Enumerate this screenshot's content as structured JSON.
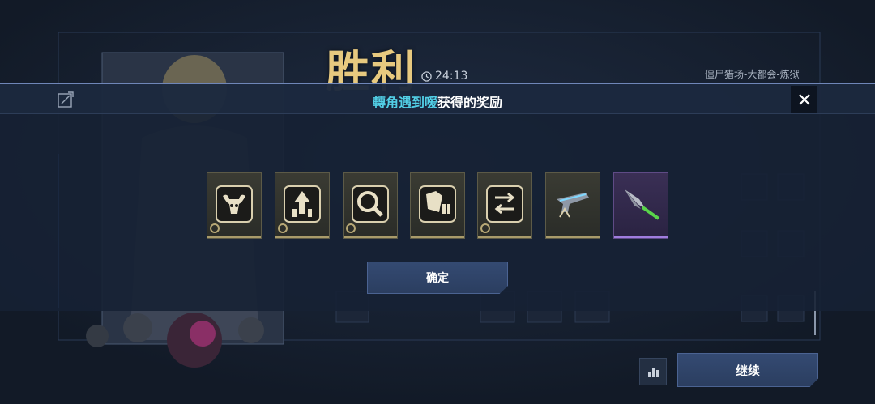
{
  "header": {
    "victory_text": "胜利",
    "timer": "24:13",
    "map_name": "僵尸猎场-大都会-炼狱"
  },
  "modal": {
    "title_highlight": "轉角遇到嗳",
    "title_rest": "获得的奖励",
    "confirm_label": "确定"
  },
  "rewards": [
    {
      "icon": "bull-skull-icon",
      "rarity": "gold"
    },
    {
      "icon": "bullets-upgrade-icon",
      "rarity": "gold"
    },
    {
      "icon": "scope-magnifier-icon",
      "rarity": "gold"
    },
    {
      "icon": "armor-bullets-icon",
      "rarity": "gold"
    },
    {
      "icon": "weapon-swap-icon",
      "rarity": "gold"
    },
    {
      "icon": "pistol-blueprint-icon",
      "rarity": "gold"
    },
    {
      "icon": "spear-blade-icon",
      "rarity": "purple"
    }
  ],
  "footer": {
    "continue_label": "继续"
  },
  "colors": {
    "victory_gold": "#e7c97f",
    "title_cyan": "#52cfe6",
    "rarity_gold": "#a99b6a",
    "rarity_purple": "#a07ddf"
  }
}
